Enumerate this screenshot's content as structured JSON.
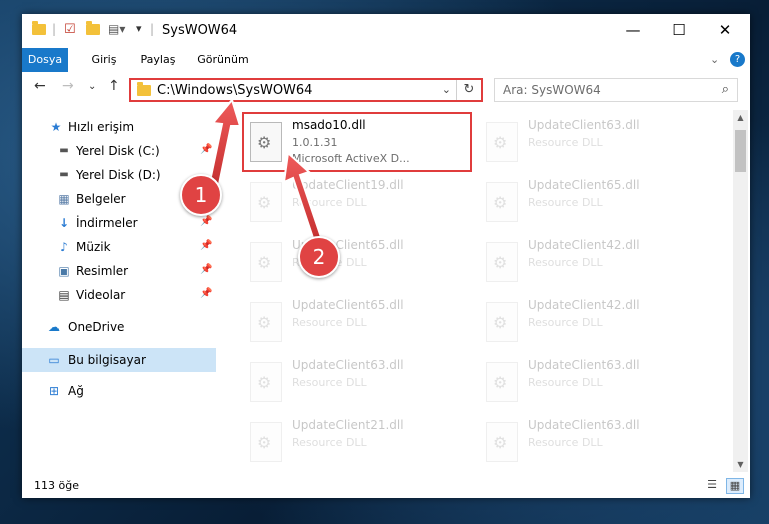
{
  "window": {
    "title": "SysWOW64",
    "controls": {
      "minimize": "—",
      "maximize": "☐",
      "close": "✕"
    }
  },
  "ribbon": {
    "tabs": [
      "Dosya",
      "Giriş",
      "Paylaş",
      "Görünüm"
    ],
    "help": "?"
  },
  "nav": {
    "address": "C:\\Windows\\SysWOW64",
    "search_placeholder": "Ara: SysWOW64"
  },
  "sidebar": {
    "items": [
      {
        "label": "Hızlı erişim",
        "icon": "star-icon",
        "pinned": false
      },
      {
        "label": "Yerel Disk (C:)",
        "icon": "drive-icon",
        "pinned": true
      },
      {
        "label": "Yerel Disk (D:)",
        "icon": "drive-icon",
        "pinned": false
      },
      {
        "label": "Belgeler",
        "icon": "documents-icon",
        "pinned": true
      },
      {
        "label": "İndirmeler",
        "icon": "download-icon",
        "pinned": true
      },
      {
        "label": "Müzik",
        "icon": "music-icon",
        "pinned": true
      },
      {
        "label": "Resimler",
        "icon": "pictures-icon",
        "pinned": true
      },
      {
        "label": "Videolar",
        "icon": "videos-icon",
        "pinned": true
      },
      {
        "label": "OneDrive",
        "icon": "cloud-icon",
        "pinned": false
      },
      {
        "label": "Bu bilgisayar",
        "icon": "computer-icon",
        "pinned": false,
        "selected": true
      },
      {
        "label": "Ağ",
        "icon": "network-icon",
        "pinned": false
      }
    ]
  },
  "files": {
    "highlighted": {
      "name": "msado10.dll",
      "version": "1.0.1.31",
      "description": "Microsoft ActiveX D..."
    },
    "background": [
      {
        "name": "UpdateClient63.dll",
        "type": "Resource DLL"
      },
      {
        "name": "UpdateClient19.dll",
        "type": "Resource DLL"
      },
      {
        "name": "UpdateClient65.dll",
        "type": "Resource DLL"
      },
      {
        "name": "UpdateClient65.dll",
        "type": "Resource DLL"
      },
      {
        "name": "UpdateClient42.dll",
        "type": "Resource DLL"
      },
      {
        "name": "UpdateClient65.dll",
        "type": "Resource DLL"
      },
      {
        "name": "UpdateClient42.dll",
        "type": "Resource DLL"
      },
      {
        "name": "UpdateClient63.dll",
        "type": "Resource DLL"
      },
      {
        "name": "UpdateClient63.dll",
        "type": "Resource DLL"
      },
      {
        "name": "UpdateClient21.dll",
        "type": "Resource DLL"
      },
      {
        "name": "UpdateClient63.dll",
        "type": "Resource DLL"
      }
    ]
  },
  "status": {
    "count": "113 öğe"
  },
  "callouts": [
    "1",
    "2"
  ],
  "colors": {
    "accent": "#1979ca",
    "highlight": "#e03c3c",
    "selected_bg": "#cce4f7"
  }
}
